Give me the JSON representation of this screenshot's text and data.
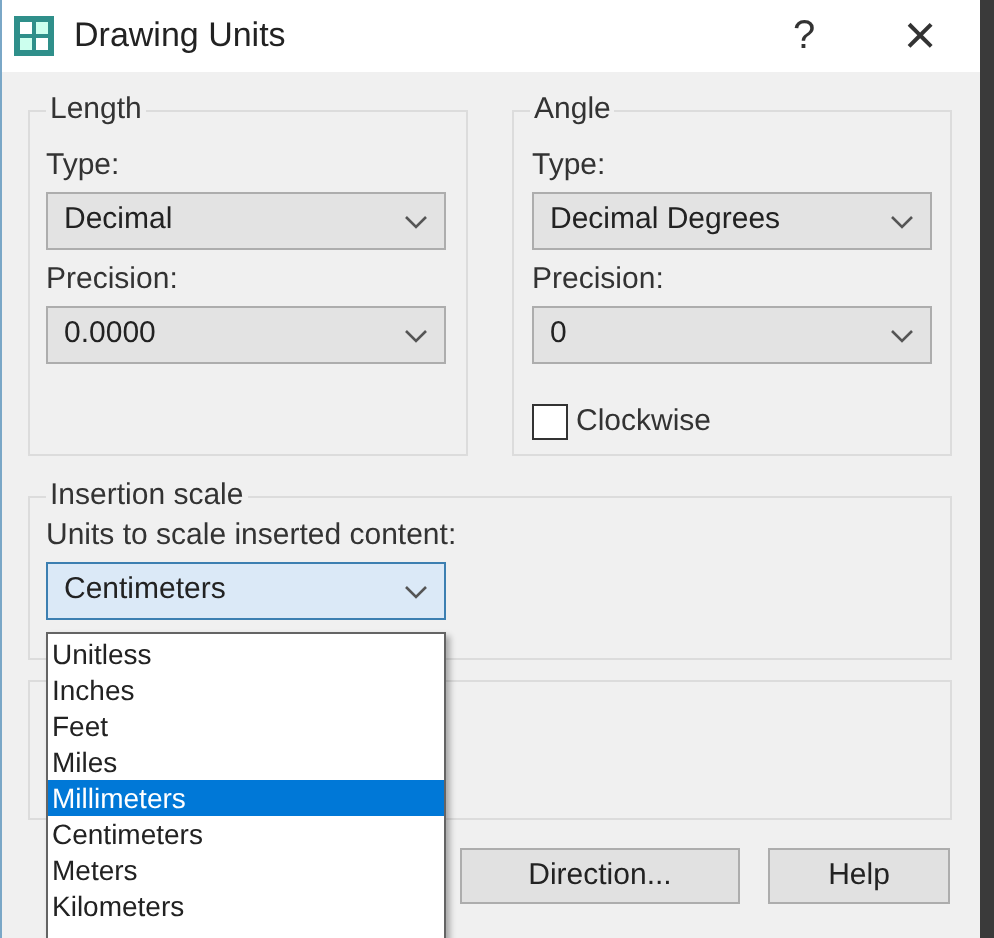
{
  "window": {
    "title": "Drawing Units",
    "help_glyph": "?",
    "close_glyph": "×"
  },
  "length": {
    "title": "Length",
    "type_label": "Type:",
    "type_value": "Decimal",
    "precision_label": "Precision:",
    "precision_value": "0.0000"
  },
  "angle": {
    "title": "Angle",
    "type_label": "Type:",
    "type_value": "Decimal Degrees",
    "precision_label": "Precision:",
    "precision_value": "0",
    "clockwise": {
      "label": "Clockwise",
      "checked": false
    }
  },
  "insertion_scale": {
    "title": "Insertion scale",
    "units_label": "Units to scale inserted content:",
    "units_value": "Centimeters",
    "expanded": true,
    "options": [
      {
        "label": "Unitless",
        "selected": false
      },
      {
        "label": "Inches",
        "selected": false
      },
      {
        "label": "Feet",
        "selected": false
      },
      {
        "label": "Miles",
        "selected": false
      },
      {
        "label": "Millimeters",
        "selected": true
      },
      {
        "label": "Centimeters",
        "selected": false
      },
      {
        "label": "Meters",
        "selected": false
      },
      {
        "label": "Kilometers",
        "selected": false
      }
    ]
  },
  "buttons": [
    {
      "label": "Direction..."
    },
    {
      "label": "Help"
    }
  ]
}
